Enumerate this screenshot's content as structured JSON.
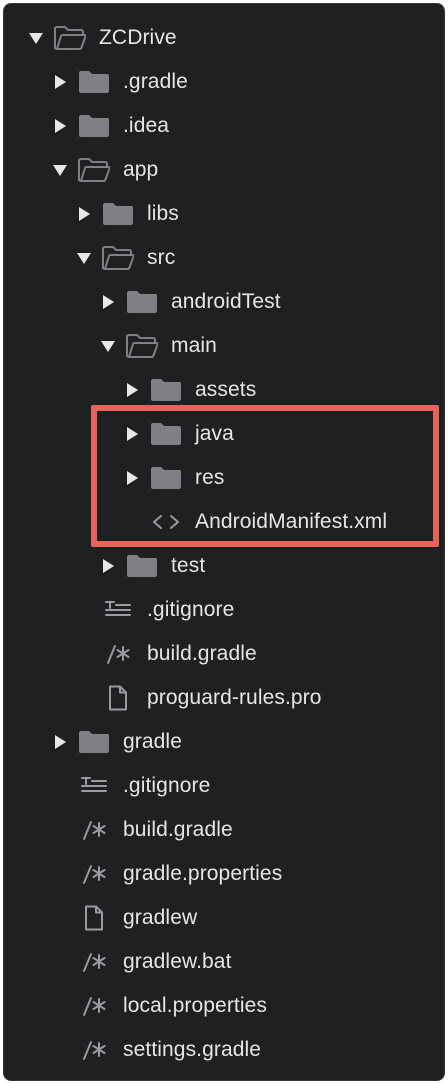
{
  "tree": {
    "root": {
      "label": "ZCDrive",
      "icon": "folder-open-icon",
      "expanded": true
    },
    "gradle_dir": {
      "label": ".gradle",
      "icon": "folder-icon"
    },
    "idea_dir": {
      "label": ".idea",
      "icon": "folder-icon"
    },
    "app": {
      "label": "app",
      "icon": "folder-open-icon",
      "expanded": true
    },
    "libs": {
      "label": "libs",
      "icon": "folder-icon"
    },
    "src": {
      "label": "src",
      "icon": "folder-open-icon",
      "expanded": true
    },
    "android_test": {
      "label": "androidTest",
      "icon": "folder-icon"
    },
    "main": {
      "label": "main",
      "icon": "folder-open-icon",
      "expanded": true
    },
    "assets": {
      "label": "assets",
      "icon": "folder-icon"
    },
    "java": {
      "label": "java",
      "icon": "folder-icon"
    },
    "res": {
      "label": "res",
      "icon": "folder-icon"
    },
    "manifest": {
      "label": "AndroidManifest.xml",
      "icon": "xml-code-icon"
    },
    "test": {
      "label": "test",
      "icon": "folder-icon"
    },
    "app_gitignore": {
      "label": ".gitignore",
      "icon": "text-lines-icon"
    },
    "app_build_gradle": {
      "label": "build.gradle",
      "icon": "comment-script-icon"
    },
    "proguard": {
      "label": "proguard-rules.pro",
      "icon": "file-icon"
    },
    "gradle": {
      "label": "gradle",
      "icon": "folder-icon"
    },
    "root_gitignore": {
      "label": ".gitignore",
      "icon": "text-lines-icon"
    },
    "root_build_gradle": {
      "label": "build.gradle",
      "icon": "comment-script-icon"
    },
    "gradle_properties": {
      "label": "gradle.properties",
      "icon": "comment-script-icon"
    },
    "gradlew": {
      "label": "gradlew",
      "icon": "file-icon"
    },
    "gradlew_bat": {
      "label": "gradlew.bat",
      "icon": "comment-script-icon"
    },
    "local_properties": {
      "label": "local.properties",
      "icon": "comment-script-icon"
    },
    "settings_gradle": {
      "label": "settings.gradle",
      "icon": "comment-script-icon"
    }
  },
  "colors": {
    "background": "#1f2022",
    "text": "#e6e6e6",
    "icon": "#7f8086",
    "highlight": "#e4635a"
  }
}
